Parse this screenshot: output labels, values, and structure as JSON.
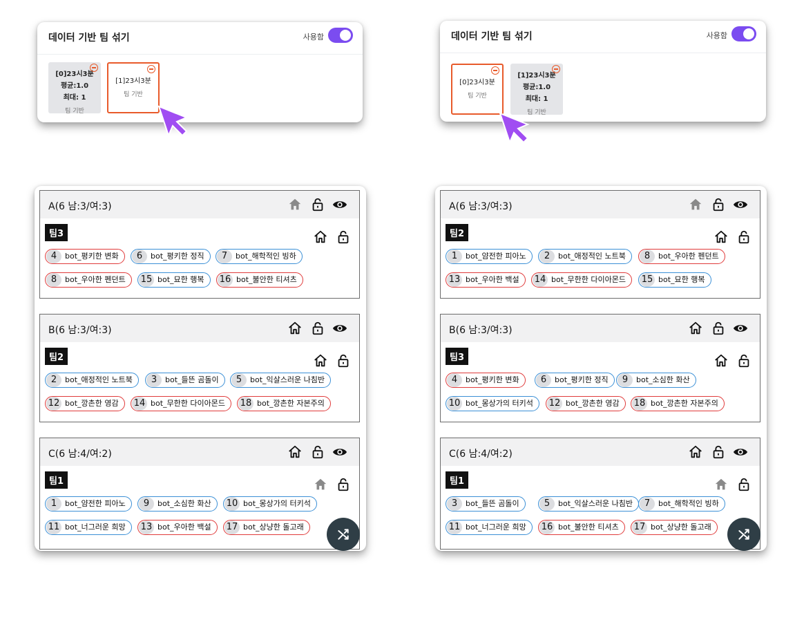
{
  "colors": {
    "accent": "#7b4cf0",
    "selected_border": "#e85a2a",
    "male_border": "#3a8fd6",
    "female_border": "#e03a3a",
    "fab": "#2f3e46"
  },
  "left": {
    "settings": {
      "title": "데이터 기반 팀 섞기",
      "use_label": "사용함",
      "toggle_on": true,
      "chips": [
        {
          "name": "[0]23시3분",
          "avg": "평균:1.0",
          "max": "최대: 1",
          "type": "팀 기반",
          "selected": false
        },
        {
          "name": "[1]23시3분",
          "type": "팀 기반",
          "selected": true
        }
      ]
    },
    "groups": [
      {
        "title": "A(6 남:3/여:3)",
        "team": "팀3",
        "members": [
          {
            "num": "4",
            "name": "bot_평키한 변화",
            "gender": "f"
          },
          {
            "num": "6",
            "name": "bot_평키한 정직",
            "gender": "m"
          },
          {
            "num": "7",
            "name": "bot_해학적인 빙하",
            "gender": "m"
          },
          {
            "num": "8",
            "name": "bot_우아한 펜던트",
            "gender": "f"
          },
          {
            "num": "15",
            "name": "bot_묘한 행복",
            "gender": "m"
          },
          {
            "num": "16",
            "name": "bot_불안한 티셔츠",
            "gender": "f"
          }
        ]
      },
      {
        "title": "B(6 남:3/여:3)",
        "team": "팀2",
        "members": [
          {
            "num": "2",
            "name": "bot_애정적인 노트북",
            "gender": "m"
          },
          {
            "num": "3",
            "name": "bot_들뜬 곰돌이",
            "gender": "m"
          },
          {
            "num": "5",
            "name": "bot_익살스러운 나침반",
            "gender": "m"
          },
          {
            "num": "12",
            "name": "bot_깡촌한 영감",
            "gender": "f"
          },
          {
            "num": "14",
            "name": "bot_무한한 다이아몬드",
            "gender": "f"
          },
          {
            "num": "18",
            "name": "bot_깡촌한 자본주의",
            "gender": "f"
          }
        ]
      },
      {
        "title": "C(6 남:4/여:2)",
        "team": "팀1",
        "members": [
          {
            "num": "1",
            "name": "bot_얌전한 피아노",
            "gender": "m"
          },
          {
            "num": "9",
            "name": "bot_소심한 화산",
            "gender": "m"
          },
          {
            "num": "10",
            "name": "bot_몽상가의 터키석",
            "gender": "m"
          },
          {
            "num": "11",
            "name": "bot_너그러운 희망",
            "gender": "m"
          },
          {
            "num": "13",
            "name": "bot_우아한 백설",
            "gender": "f"
          },
          {
            "num": "17",
            "name": "bot_상냥한 돌고래",
            "gender": "f"
          }
        ]
      }
    ]
  },
  "right": {
    "settings": {
      "title": "데이터 기반 팀 섞기",
      "use_label": "사용함",
      "toggle_on": true,
      "chips": [
        {
          "name": "[0]23시3분",
          "type": "팀 기반",
          "selected": true
        },
        {
          "name": "[1]23시3분",
          "avg": "평균:1.0",
          "max": "최대: 1",
          "type": "팀 기반",
          "selected": false
        }
      ]
    },
    "groups": [
      {
        "title": "A(6 남:3/여:3)",
        "team": "팀2",
        "members": [
          {
            "num": "1",
            "name": "bot_얌전한 피아노",
            "gender": "m"
          },
          {
            "num": "2",
            "name": "bot_애정적인 노트북",
            "gender": "m"
          },
          {
            "num": "8",
            "name": "bot_우아한 펜던트",
            "gender": "f"
          },
          {
            "num": "13",
            "name": "bot_우아한 백설",
            "gender": "f"
          },
          {
            "num": "14",
            "name": "bot_무한한 다이아몬드",
            "gender": "f"
          },
          {
            "num": "15",
            "name": "bot_묘한 행복",
            "gender": "m"
          }
        ]
      },
      {
        "title": "B(6 남:3/여:3)",
        "team": "팀3",
        "members": [
          {
            "num": "4",
            "name": "bot_평키한 변화",
            "gender": "f"
          },
          {
            "num": "6",
            "name": "bot_평키한 정직",
            "gender": "m"
          },
          {
            "num": "9",
            "name": "bot_소심한 화산",
            "gender": "m"
          },
          {
            "num": "10",
            "name": "bot_몽상가의 터키석",
            "gender": "m"
          },
          {
            "num": "12",
            "name": "bot_깡촌한 영감",
            "gender": "f"
          },
          {
            "num": "18",
            "name": "bot_깡촌한 자본주의",
            "gender": "f"
          }
        ]
      },
      {
        "title": "C(6 남:4/여:2)",
        "team": "팀1",
        "members": [
          {
            "num": "3",
            "name": "bot_들뜬 곰돌이",
            "gender": "m"
          },
          {
            "num": "5",
            "name": "bot_익살스러운 나침반",
            "gender": "m"
          },
          {
            "num": "7",
            "name": "bot_해학적인 빙하",
            "gender": "m"
          },
          {
            "num": "11",
            "name": "bot_너그러운 희망",
            "gender": "m"
          },
          {
            "num": "16",
            "name": "bot_불안한 티셔츠",
            "gender": "f"
          },
          {
            "num": "17",
            "name": "bot_상냥한 돌고래",
            "gender": "f"
          }
        ]
      }
    ]
  }
}
